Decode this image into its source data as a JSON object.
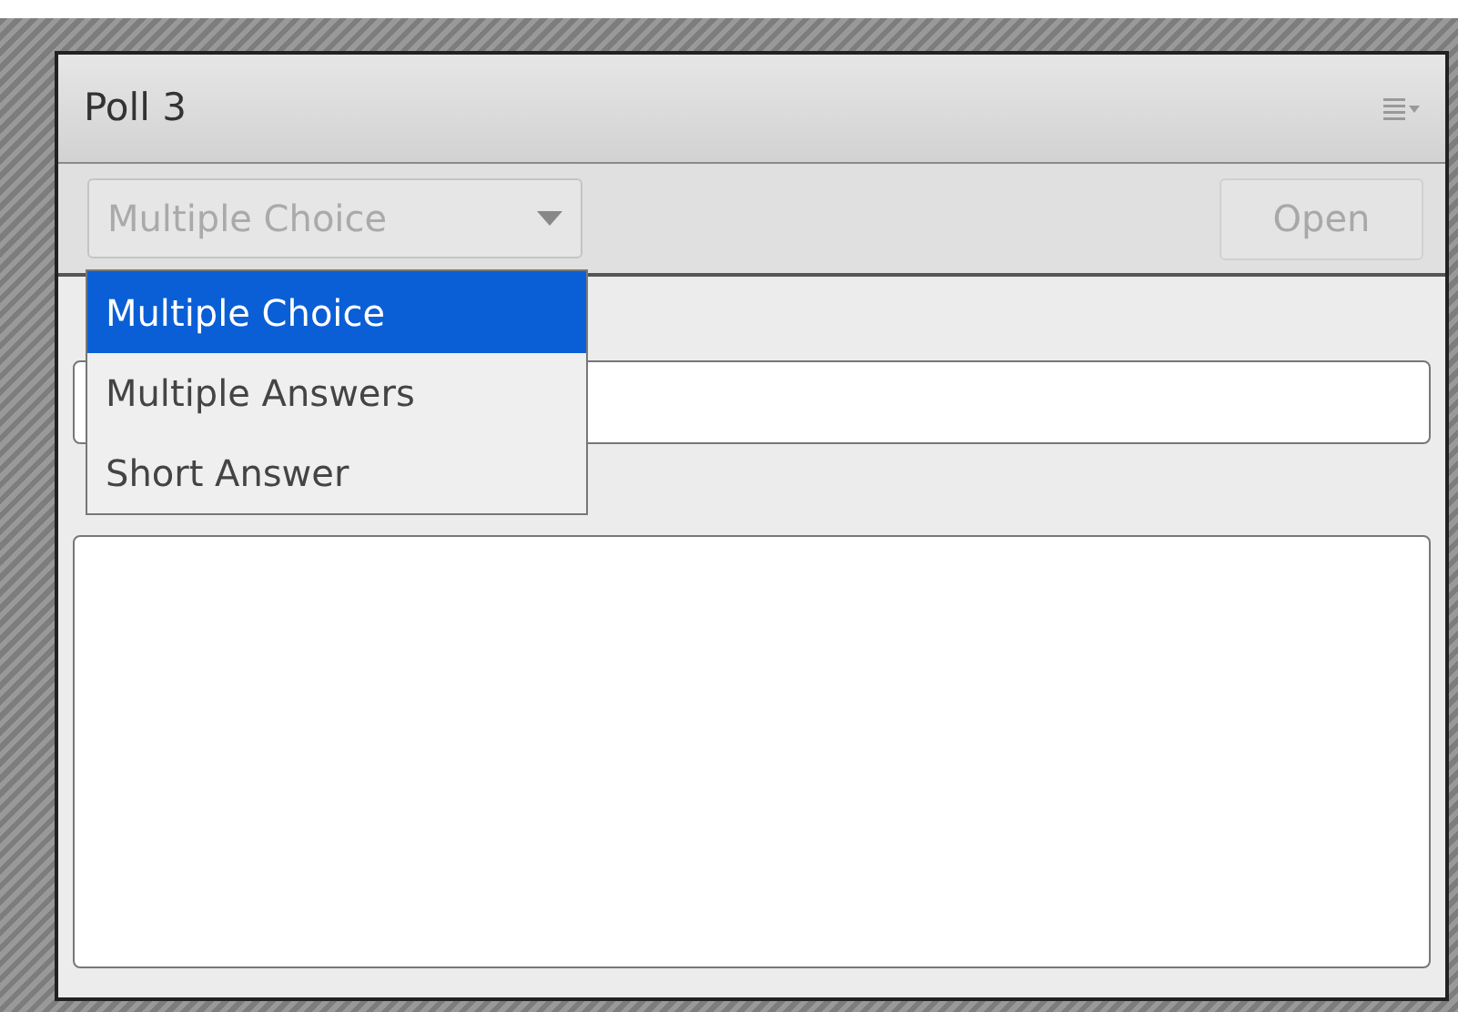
{
  "panel": {
    "title": "Poll 3"
  },
  "question_type": {
    "value": "Multiple Choice",
    "disabled": true,
    "expanded": true,
    "options": [
      {
        "label": "Multiple Choice",
        "selected": true
      },
      {
        "label": "Multiple Answers",
        "selected": false
      },
      {
        "label": "Short Answer",
        "selected": false
      }
    ]
  },
  "open_button": {
    "label": "Open",
    "disabled": true
  }
}
